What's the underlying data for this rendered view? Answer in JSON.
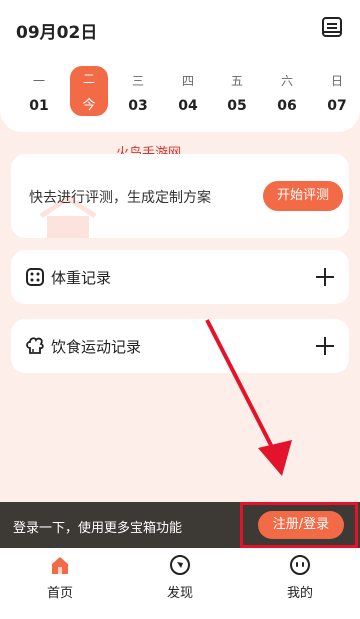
{
  "header": {
    "date": "09月02日",
    "calendar_icon": "calendar-icon"
  },
  "week": [
    {
      "weekday": "一",
      "day": "01",
      "active": false
    },
    {
      "weekday": "二",
      "day": "今",
      "active": true
    },
    {
      "weekday": "三",
      "day": "03",
      "active": false
    },
    {
      "weekday": "四",
      "day": "04",
      "active": false
    },
    {
      "weekday": "五",
      "day": "05",
      "active": false
    },
    {
      "weekday": "六",
      "day": "06",
      "active": false
    },
    {
      "weekday": "日",
      "day": "07",
      "active": false
    }
  ],
  "watermark": "火鸟手游网",
  "assessment": {
    "text": "快去进行评测，生成定制方案",
    "button": "开始评测"
  },
  "records": {
    "weight": {
      "label": "体重记录",
      "icon": "dice-scale-icon"
    },
    "diet": {
      "label": "饮食运动记录",
      "icon": "chef-hat-icon"
    }
  },
  "login_banner": {
    "text": "登录一下，使用更多宝箱功能",
    "button": "注册/登录"
  },
  "tabbar": {
    "tabs": [
      {
        "label": "首页",
        "icon": "home-icon",
        "active": true
      },
      {
        "label": "发现",
        "icon": "compass-icon",
        "active": false
      },
      {
        "label": "我的",
        "icon": "profile-face-icon",
        "active": false
      }
    ]
  },
  "colors": {
    "accent": "#f36b46",
    "background": "#fdeee9",
    "banner": "#3d3935",
    "highlight": "#e2132a"
  }
}
